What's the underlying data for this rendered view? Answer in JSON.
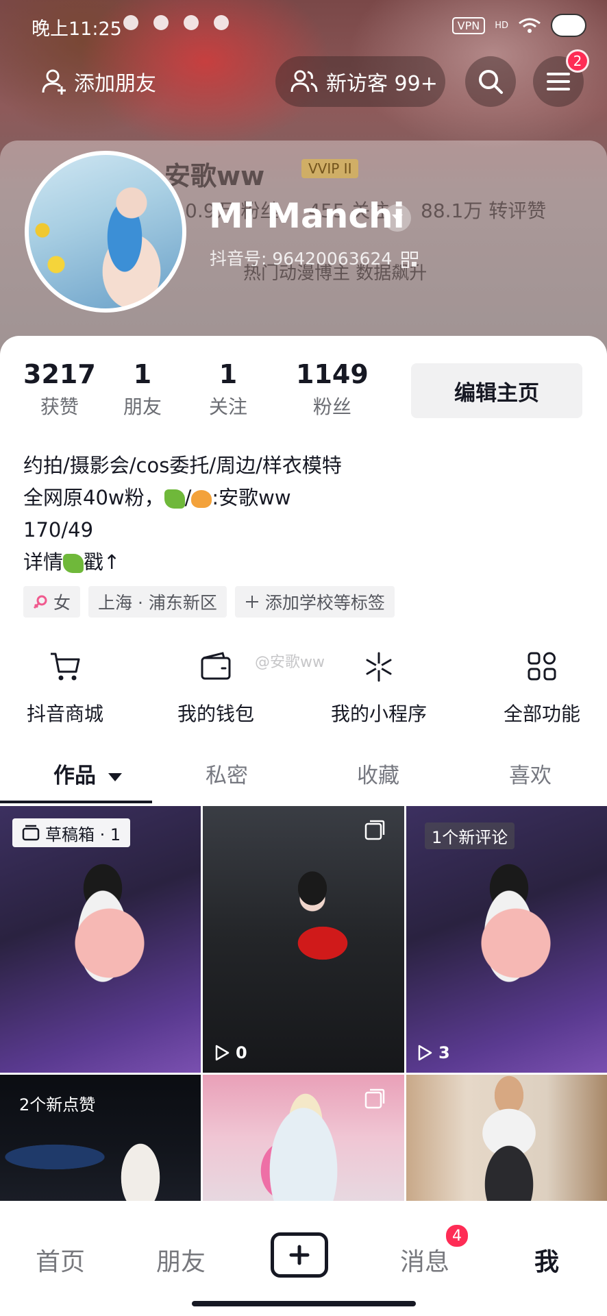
{
  "status_bar": {
    "time": "晚上11:25",
    "vpn": "VPN",
    "hd": "HD"
  },
  "header": {
    "add_friend_label": "添加朋友",
    "visitors_label": "新访客 99+",
    "menu_badge": "2"
  },
  "profile": {
    "display_name": "Mi Manchi",
    "douyin_id": "抖音号: 96420063624",
    "ghost": {
      "name": "安歌ww",
      "vip": "VVIP II",
      "fans": "0.9万 粉丝",
      "following": "455 关注",
      "likes": "88.1万 转评赞",
      "subtitle": "热门动漫博主 数据飙升"
    }
  },
  "stats": [
    {
      "value": "3217",
      "label": "获赞"
    },
    {
      "value": "1",
      "label": "朋友"
    },
    {
      "value": "1",
      "label": "关注"
    },
    {
      "value": "1149",
      "label": "粉丝"
    }
  ],
  "edit_profile_label": "编辑主页",
  "bio": {
    "line1": "约拍/摄影会/cos委托/周边/样衣模特",
    "line2_a": "全网原40w粉，",
    "line2_b": "/",
    "line2_c": ":安歌ww",
    "line3": "170/49",
    "line4_a": "详情",
    "line4_b": "戳↑"
  },
  "tags": {
    "gender": "女",
    "location": "上海 · 浦东新区",
    "add_tag": "添加学校等标签"
  },
  "features": [
    {
      "label": "抖音商城",
      "icon": "cart-icon"
    },
    {
      "label": "我的钱包",
      "icon": "wallet-icon"
    },
    {
      "label": "我的小程序",
      "icon": "mini-program-icon"
    },
    {
      "label": "全部功能",
      "icon": "grid-icon"
    }
  ],
  "watermark": "@安歌ww",
  "tabs": [
    {
      "label": "作品"
    },
    {
      "label": "私密"
    },
    {
      "label": "收藏"
    },
    {
      "label": "喜欢"
    }
  ],
  "grid": {
    "drafts": "草稿箱 · 1",
    "video2_plays": "0",
    "video3_label": "1个新评论",
    "video3_plays": "3",
    "video4_label": "2个新点赞"
  },
  "bottom_nav": {
    "home": "首页",
    "friends": "朋友",
    "messages": "消息",
    "messages_badge": "4",
    "me": "我"
  }
}
